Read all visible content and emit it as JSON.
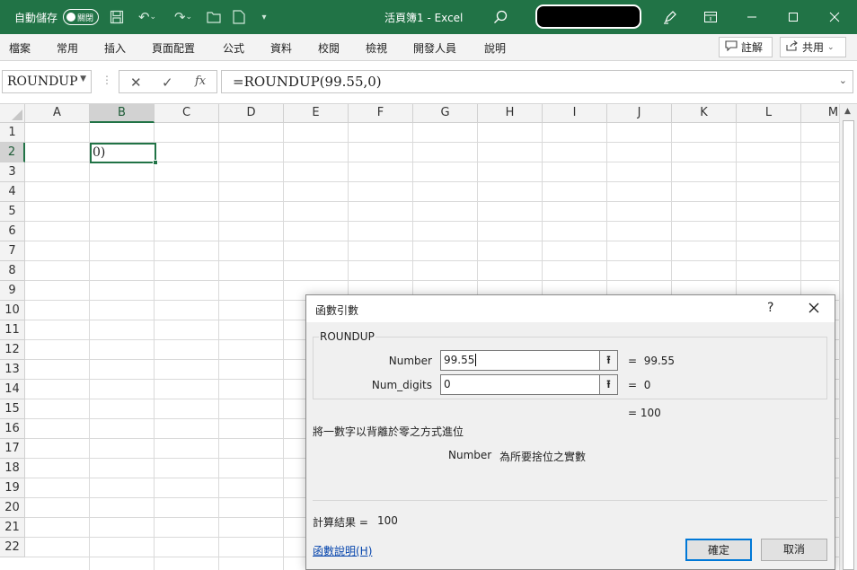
{
  "app": {
    "autosave_label": "自動儲存",
    "autosave_state": "關閉",
    "title": "活頁簿1  -  Excel"
  },
  "colors": {
    "brand": "#217346",
    "dialog_primary_border": "#0078d7"
  },
  "icons": {
    "save": "save-icon",
    "undo": "undo-icon",
    "redo": "redo-icon",
    "search": "search-icon",
    "pen": "pen-icon",
    "ribbon_display": "ribbon-display-icon",
    "minimize": "minimize-icon",
    "maximize": "maximize-icon",
    "close": "close-icon"
  },
  "menu": {
    "items": [
      "檔案",
      "常用",
      "插入",
      "頁面配置",
      "公式",
      "資料",
      "校閱",
      "檢視",
      "開發人員",
      "說明"
    ],
    "comments_label": "註解",
    "share_label": "共用"
  },
  "formula_bar": {
    "name_box": "ROUNDUP",
    "formula": "=ROUNDUP(99.55,0)",
    "fx_label": "fx"
  },
  "grid": {
    "columns": [
      "A",
      "B",
      "C",
      "D",
      "E",
      "F",
      "G",
      "H",
      "I",
      "J",
      "K",
      "L",
      "M"
    ],
    "rows": [
      "1",
      "2",
      "3",
      "4",
      "5",
      "6",
      "7",
      "8",
      "9",
      "10",
      "11",
      "12",
      "13",
      "14",
      "15",
      "16",
      "17",
      "18",
      "19",
      "20",
      "21",
      "22"
    ],
    "selected_column": "B",
    "selected_row": "2",
    "active_cell_text": "0)"
  },
  "dialog": {
    "title": "函數引數",
    "help": "?",
    "function_name": "ROUNDUP",
    "args": [
      {
        "label": "Number",
        "value": "99.55",
        "result": "99.55"
      },
      {
        "label": "Num_digits",
        "value": "0",
        "result": "0"
      }
    ],
    "result_line": "=  100",
    "description": "將一數字以背離於零之方式進位",
    "arg_help_name": "Number",
    "arg_help_text": "為所要捨位之實數",
    "calc_label": "計算結果 =",
    "calc_value": "100",
    "help_link": "函數說明(H)",
    "ok_label": "確定",
    "cancel_label": "取消"
  }
}
